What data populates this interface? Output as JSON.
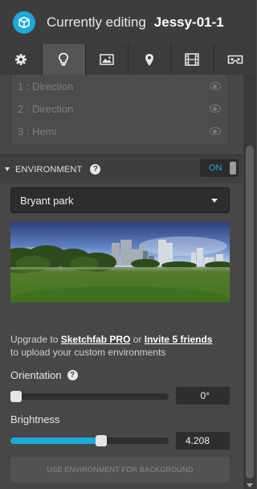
{
  "header": {
    "prefix": "Currently editing",
    "model_name": "Jessy-01-1"
  },
  "tabs": [
    {
      "name": "gear-icon",
      "active": false
    },
    {
      "name": "lightbulb-icon",
      "active": true
    },
    {
      "name": "image-icon",
      "active": false
    },
    {
      "name": "map-pin-icon",
      "active": false
    },
    {
      "name": "film-icon",
      "active": false
    },
    {
      "name": "vr-headset-icon",
      "active": false
    }
  ],
  "lights": [
    {
      "label": "1 : Direction"
    },
    {
      "label": "2 : Direction"
    },
    {
      "label": "3 : Hemi"
    }
  ],
  "environment": {
    "title": "ENVIRONMENT",
    "toggle_label": "ON",
    "selected": "Bryant park",
    "upgrade_prefix": "Upgrade to ",
    "pro_link": "Sketchfab PRO",
    "or_text": " or ",
    "invite_link": "Invite 5 friends",
    "upgrade_suffix": "to upload your custom environments",
    "orientation_label": "Orientation",
    "orientation_value": "0°",
    "orientation_fraction": 0.0,
    "brightness_label": "Brightness",
    "brightness_value": "4.208",
    "brightness_fraction": 0.58,
    "bg_button": "USE ENVIRONMENT FOR BACKGROUND"
  },
  "colors": {
    "accent": "#1caad9"
  }
}
